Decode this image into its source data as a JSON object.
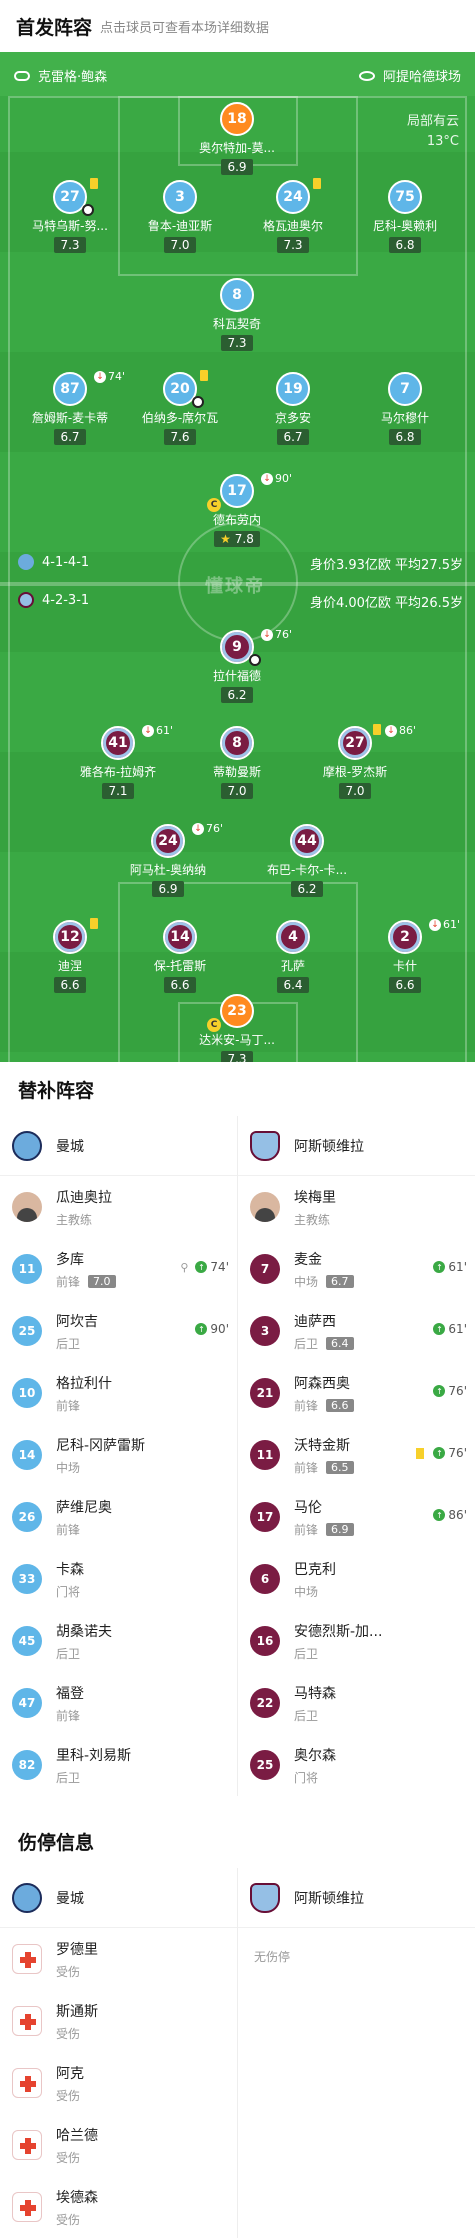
{
  "header": {
    "title": "首发阵容",
    "subtitle": "点击球员可查看本场详细数据"
  },
  "match": {
    "referee": "克雷格·鲍森",
    "stadium": "阿提哈德球场",
    "weather": "局部有云",
    "temperature": "13°C",
    "watermark": "懂球帝"
  },
  "home": {
    "name": "曼城",
    "formation": "4-1-4-1",
    "value": "身价3.93亿欧",
    "avg_age": "平均27.5岁",
    "players": [
      {
        "num": "18",
        "name": "奥尔特加-莫...",
        "rating": "6.9"
      },
      {
        "num": "27",
        "name": "马特乌斯-努...",
        "rating": "7.3"
      },
      {
        "num": "3",
        "name": "鲁本-迪亚斯",
        "rating": "7.0"
      },
      {
        "num": "24",
        "name": "格瓦迪奥尔",
        "rating": "7.3"
      },
      {
        "num": "75",
        "name": "尼科-奥赖利",
        "rating": "6.8"
      },
      {
        "num": "8",
        "name": "科瓦契奇",
        "rating": "7.3"
      },
      {
        "num": "87",
        "name": "詹姆斯-麦卡蒂",
        "rating": "6.7",
        "event": "74'"
      },
      {
        "num": "20",
        "name": "伯纳多-席尔瓦",
        "rating": "7.6"
      },
      {
        "num": "19",
        "name": "京多安",
        "rating": "6.7"
      },
      {
        "num": "7",
        "name": "马尔穆什",
        "rating": "6.8"
      },
      {
        "num": "17",
        "name": "德布劳内",
        "rating": "7.8",
        "event": "90'"
      }
    ]
  },
  "away": {
    "name": "阿斯顿维拉",
    "formation": "4-2-3-1",
    "value": "身价4.00亿欧",
    "avg_age": "平均26.5岁",
    "players": [
      {
        "num": "9",
        "name": "拉什福德",
        "rating": "6.2",
        "event": "76'"
      },
      {
        "num": "41",
        "name": "雅各布-拉姆齐",
        "rating": "7.1",
        "event": "61'"
      },
      {
        "num": "8",
        "name": "蒂勒曼斯",
        "rating": "7.0"
      },
      {
        "num": "27",
        "name": "摩根-罗杰斯",
        "rating": "7.0",
        "event": "86'"
      },
      {
        "num": "24",
        "name": "阿马杜-奥纳纳",
        "rating": "6.9",
        "event": "76'"
      },
      {
        "num": "44",
        "name": "布巴-卡尔-卡...",
        "rating": "6.2"
      },
      {
        "num": "12",
        "name": "迪涅",
        "rating": "6.6"
      },
      {
        "num": "14",
        "name": "保-托雷斯",
        "rating": "6.6"
      },
      {
        "num": "4",
        "name": "孔萨",
        "rating": "6.4"
      },
      {
        "num": "2",
        "name": "卡什",
        "rating": "6.6",
        "event": "61'"
      },
      {
        "num": "23",
        "name": "达米安-马丁...",
        "rating": "7.3"
      }
    ]
  },
  "subs": {
    "title": "替补阵容",
    "home_coach": {
      "name": "瓜迪奥拉",
      "role": "主教练"
    },
    "away_coach": {
      "name": "埃梅里",
      "role": "主教练"
    },
    "home": [
      {
        "num": "11",
        "name": "多库",
        "pos": "前锋",
        "rating": "7.0",
        "minute": "74'"
      },
      {
        "num": "25",
        "name": "阿坎吉",
        "pos": "后卫",
        "minute": "90'"
      },
      {
        "num": "10",
        "name": "格拉利什",
        "pos": "前锋"
      },
      {
        "num": "14",
        "name": "尼科-冈萨雷斯",
        "pos": "中场"
      },
      {
        "num": "26",
        "name": "萨维尼奥",
        "pos": "前锋"
      },
      {
        "num": "33",
        "name": "卡森",
        "pos": "门将"
      },
      {
        "num": "45",
        "name": "胡桑诺夫",
        "pos": "后卫"
      },
      {
        "num": "47",
        "name": "福登",
        "pos": "前锋"
      },
      {
        "num": "82",
        "name": "里科-刘易斯",
        "pos": "后卫"
      }
    ],
    "away": [
      {
        "num": "7",
        "name": "麦金",
        "pos": "中场",
        "rating": "6.7",
        "minute": "61'"
      },
      {
        "num": "3",
        "name": "迪萨西",
        "pos": "后卫",
        "rating": "6.4",
        "minute": "61'"
      },
      {
        "num": "21",
        "name": "阿森西奥",
        "pos": "前锋",
        "rating": "6.6",
        "minute": "76'"
      },
      {
        "num": "11",
        "name": "沃特金斯",
        "pos": "前锋",
        "rating": "6.5",
        "minute": "76'"
      },
      {
        "num": "17",
        "name": "马伦",
        "pos": "前锋",
        "rating": "6.9",
        "minute": "86'"
      },
      {
        "num": "6",
        "name": "巴克利",
        "pos": "中场"
      },
      {
        "num": "16",
        "name": "安德烈斯-加...",
        "pos": "后卫"
      },
      {
        "num": "22",
        "name": "马特森",
        "pos": "后卫"
      },
      {
        "num": "25",
        "name": "奥尔森",
        "pos": "门将"
      }
    ]
  },
  "injuries": {
    "title": "伤停信息",
    "none_label": "无伤停",
    "home": [
      {
        "name": "罗德里",
        "status": "受伤"
      },
      {
        "name": "斯通斯",
        "status": "受伤"
      },
      {
        "name": "阿克",
        "status": "受伤"
      },
      {
        "name": "哈兰德",
        "status": "受伤"
      },
      {
        "name": "埃德森",
        "status": "受伤"
      }
    ]
  },
  "colors": {
    "pitch": "#3aa944",
    "home": "#5fb6e8",
    "away": "#7a1c43",
    "gk": "#ff8a1f"
  }
}
